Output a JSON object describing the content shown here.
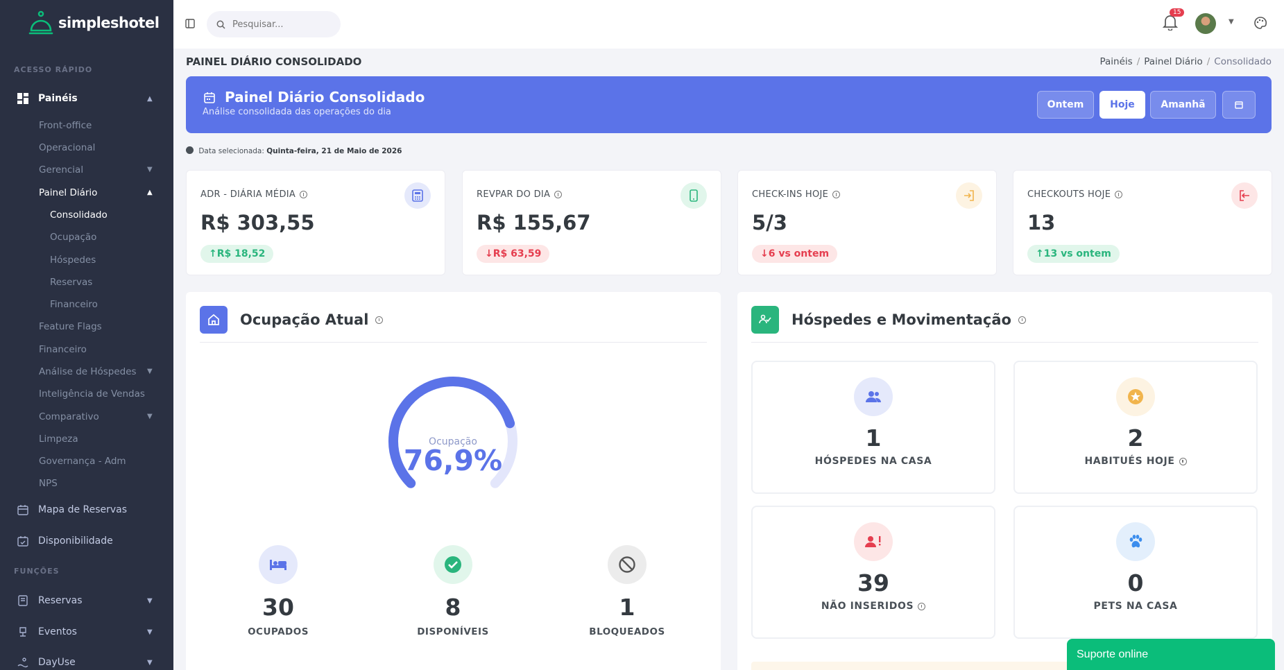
{
  "app": {
    "name": "simpleshotel"
  },
  "sidebar": {
    "section_quick": "ACESSO RÁPIDO",
    "section_functions": "FUNÇÕES",
    "paineis": "Painéis",
    "sub": [
      "Front-office",
      "Operacional",
      "Gerencial",
      "Painel Diário"
    ],
    "painel_sub": [
      "Consolidado",
      "Ocupação",
      "Hóspedes",
      "Reservas",
      "Financeiro"
    ],
    "more": [
      "Feature Flags",
      "Financeiro",
      "Análise de Hóspedes",
      "Inteligência de Vendas",
      "Comparativo",
      "Limpeza",
      "Governança - Adm",
      "NPS"
    ],
    "mapa": "Mapa de Reservas",
    "disponibilidade": "Disponibilidade",
    "reservas": "Reservas",
    "eventos": "Eventos",
    "dayuse": "DayUse"
  },
  "topbar": {
    "search_placeholder": "Pesquisar...",
    "notifications": "15"
  },
  "page": {
    "title": "PAINEL DIÁRIO CONSOLIDADO",
    "breadcrumb": [
      "Painéis",
      "Painel Diário",
      "Consolidado"
    ]
  },
  "hero": {
    "title": "Painel Diário Consolidado",
    "subtitle": "Análise consolidada das operações do dia",
    "btn_ontem": "Ontem",
    "btn_hoje": "Hoje",
    "btn_amanha": "Amanhã"
  },
  "date": {
    "label": "Data selecionada:",
    "value": "Quinta-feira, 21 de Maio de 2026"
  },
  "kpis": [
    {
      "label": "ADR - DIÁRIA MÉDIA",
      "value": "R$ 303,55",
      "badge": "R$ 18,52",
      "dir": "up",
      "color": "#5b73e8",
      "bg": "#e5e9fb"
    },
    {
      "label": "REVPAR DO DIA",
      "value": "R$ 155,67",
      "badge": "R$ 63,59",
      "dir": "down",
      "color": "#2ab57d",
      "bg": "#e1f6eb"
    },
    {
      "label": "CHECK-INS HOJE",
      "value": "5/3",
      "badge": "6 vs ontem",
      "dir": "down",
      "color": "#f1b44c",
      "bg": "#fdf3e2"
    },
    {
      "label": "CHECKOUTS HOJE",
      "value": "13",
      "badge": "13 vs ontem",
      "dir": "up",
      "color": "#e53e4f",
      "bg": "#fde6e6"
    }
  ],
  "ocupacao": {
    "title": "Ocupação Atual",
    "gauge_label": "Ocupação",
    "gauge_value": "76,9%",
    "gauge_fraction": 0.769,
    "stats": [
      {
        "value": "30",
        "label": "OCUPADOS"
      },
      {
        "value": "8",
        "label": "DISPONÍVEIS"
      },
      {
        "value": "1",
        "label": "BLOQUEADOS"
      }
    ]
  },
  "hospedes": {
    "title": "Hóspedes e Movimentação",
    "boxes": [
      {
        "value": "1",
        "label": "HÓSPEDES NA CASA"
      },
      {
        "value": "2",
        "label": "HABITUÉS HOJE"
      },
      {
        "value": "39",
        "label": "NÃO INSERIDOS"
      },
      {
        "value": "0",
        "label": "PETS NA CASA"
      }
    ]
  },
  "support": {
    "label": "Suporte online"
  }
}
